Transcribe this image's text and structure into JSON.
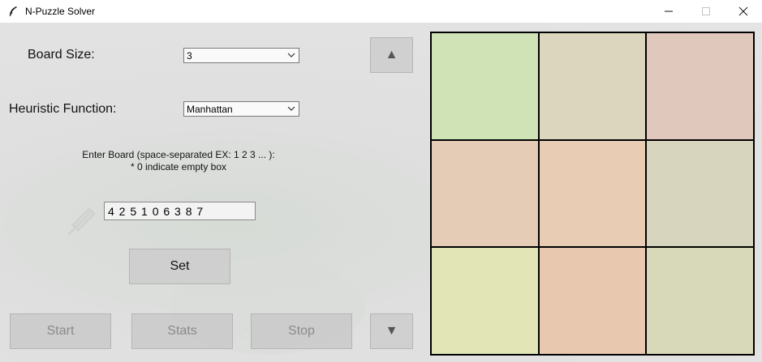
{
  "window": {
    "title": "N-Puzzle Solver",
    "app_icon": "feather-icon",
    "minimize_icon": "minimize-icon",
    "maximize_icon": "maximize-icon",
    "close_icon": "close-icon"
  },
  "controls": {
    "board_size_label": "Board Size:",
    "board_size_value": "3",
    "heuristic_label": "Heuristic Function:",
    "heuristic_value": "Manhattan",
    "hint_line1": "Enter Board (space-separated EX: 1 2 3 ...  ):",
    "hint_line2": "* 0 indicate empty box",
    "board_input_value": "4 2 5 1 0 6 3 8 7",
    "set_label": "Set",
    "up_label": "▲",
    "down_label": "▼",
    "start_label": "Start",
    "stats_label": "Stats",
    "stop_label": "Stop"
  },
  "board": {
    "size": 3,
    "tile_colors": [
      "#cfe3b6",
      "#dcd6bf",
      "#e0c8bc",
      "#e5ccb6",
      "#e8cdb4",
      "#d8d5bf",
      "#e2e6b7",
      "#e8c9b0",
      "#d8d9b8"
    ]
  }
}
